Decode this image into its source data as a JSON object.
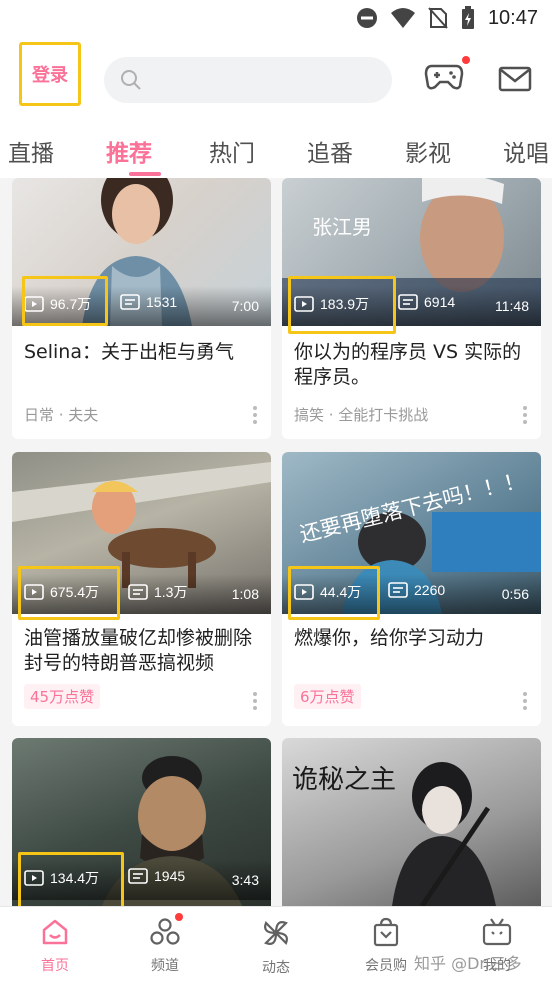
{
  "status_bar": {
    "time": "10:47"
  },
  "header": {
    "login_label": "登录",
    "search_placeholder": ""
  },
  "tabs": [
    {
      "label": "直播",
      "active": false
    },
    {
      "label": "推荐",
      "active": true
    },
    {
      "label": "热门",
      "active": false
    },
    {
      "label": "追番",
      "active": false
    },
    {
      "label": "影视",
      "active": false
    },
    {
      "label": "说唱",
      "active": false
    }
  ],
  "cards": [
    {
      "thumb_caption": "",
      "plays": "96.7万",
      "danmaku": "1531",
      "duration": "7:00",
      "title": "Selina：关于出柜与勇气",
      "meta": "日常 · 夫夫",
      "badge": ""
    },
    {
      "thumb_caption": "张江男",
      "plays": "183.9万",
      "danmaku": "6914",
      "duration": "11:48",
      "title": "你以为的程序员 VS 实际的程序员。",
      "meta": "搞笑 · 全能打卡挑战",
      "badge": ""
    },
    {
      "thumb_caption": "",
      "plays": "675.4万",
      "danmaku": "1.3万",
      "duration": "1:08",
      "title": "油管播放量破亿却惨被删除封号的特朗普恶搞视频",
      "meta": "",
      "badge": "45万点赞"
    },
    {
      "thumb_caption": "还要再堕落下去吗！！！",
      "plays": "44.4万",
      "danmaku": "2260",
      "duration": "0:56",
      "title": "燃爆你，给你学习动力",
      "meta": "",
      "badge": "6万点赞"
    },
    {
      "thumb_caption": "",
      "plays": "134.4万",
      "danmaku": "1945",
      "duration": "3:43",
      "title": "",
      "meta": "",
      "badge": ""
    },
    {
      "thumb_caption": "诡秘之主",
      "plays": "",
      "danmaku": "",
      "duration": "",
      "title": "",
      "meta": "",
      "badge": ""
    }
  ],
  "bottom_nav": [
    {
      "label": "首页",
      "icon": "home-icon",
      "active": true
    },
    {
      "label": "频道",
      "icon": "channel-icon",
      "active": false
    },
    {
      "label": "动态",
      "icon": "pinwheel-icon",
      "active": false
    },
    {
      "label": "会员购",
      "icon": "shopping-bag-icon",
      "active": false
    },
    {
      "label": "我的",
      "icon": "tv-icon",
      "active": false
    }
  ],
  "watermark": "知乎 @Dr.三多",
  "colors": {
    "accent": "#fb7299",
    "highlight": "#f5c518"
  }
}
